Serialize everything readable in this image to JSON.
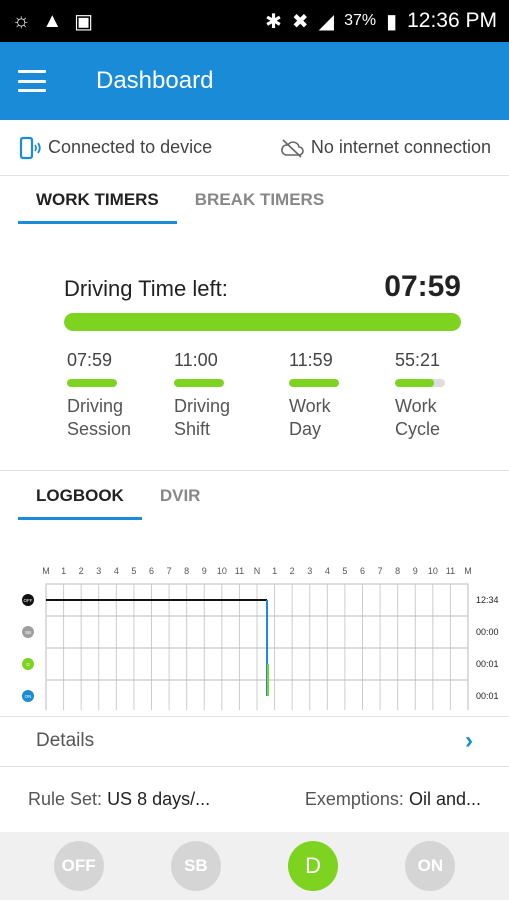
{
  "status_bar": {
    "battery": "37%",
    "time": "12:36 PM"
  },
  "app_bar": {
    "title": "Dashboard"
  },
  "connection": {
    "device": "Connected to device",
    "internet": "No internet connection"
  },
  "timer_tabs": [
    {
      "label": "WORK TIMERS",
      "active": true
    },
    {
      "label": "BREAK TIMERS",
      "active": false
    }
  ],
  "driving_time": {
    "label": "Driving Time left:",
    "value": "07:59",
    "fill_pct": 100
  },
  "sub_timers": [
    {
      "time": "07:59",
      "label1": "Driving",
      "label2": "Session",
      "fill_pct": 100
    },
    {
      "time": "11:00",
      "label1": "Driving",
      "label2": "Shift",
      "fill_pct": 100
    },
    {
      "time": "11:59",
      "label1": "Work",
      "label2": "Day",
      "fill_pct": 100
    },
    {
      "time": "55:21",
      "label1": "Work",
      "label2": "Cycle",
      "fill_pct": 78
    }
  ],
  "log_tabs": [
    {
      "label": "LOGBOOK",
      "active": true
    },
    {
      "label": "DVIR",
      "active": false
    }
  ],
  "logbook": {
    "hour_labels": [
      "M",
      "1",
      "2",
      "3",
      "4",
      "5",
      "6",
      "7",
      "8",
      "9",
      "10",
      "11",
      "N",
      "1",
      "2",
      "3",
      "4",
      "5",
      "6",
      "7",
      "8",
      "9",
      "10",
      "11",
      "M"
    ],
    "rows": [
      {
        "status": "OFF",
        "total": "12:34",
        "color": "#111111"
      },
      {
        "status": "SB",
        "total": "00:00",
        "color": "#9e9e9e"
      },
      {
        "status": "D",
        "total": "00:01",
        "color": "#7ed321"
      },
      {
        "status": "ON",
        "total": "00:01",
        "color": "#1a8bd6"
      }
    ],
    "segments": [
      {
        "row": 0,
        "start_hour": 0,
        "end_hour": 12.57
      }
    ],
    "current_hour": 12.57
  },
  "details": {
    "label": "Details"
  },
  "rules": {
    "rule_set_label": "Rule Set:",
    "rule_set_value": "US 8 days/...",
    "exemptions_label": "Exemptions:",
    "exemptions_value": "Oil and..."
  },
  "status_buttons": [
    {
      "label": "OFF",
      "active": false
    },
    {
      "label": "SB",
      "active": false
    },
    {
      "label": "D",
      "active": true
    },
    {
      "label": "ON",
      "active": false
    }
  ]
}
